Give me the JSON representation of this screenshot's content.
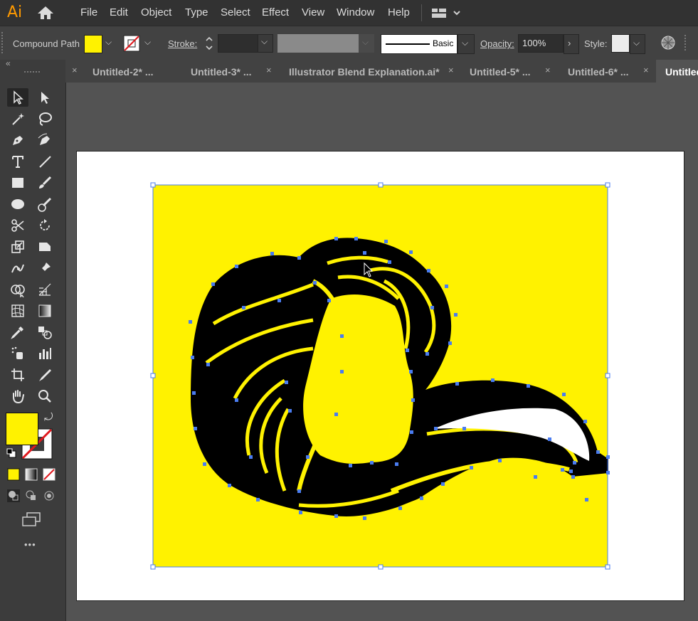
{
  "app": {
    "logo": "Ai"
  },
  "menu": {
    "items": [
      "File",
      "Edit",
      "Object",
      "Type",
      "Select",
      "Effect",
      "View",
      "Window",
      "Help"
    ]
  },
  "control": {
    "selection_label": "Compound Path",
    "fill_color": "#fff200",
    "stroke_label": "Stroke:",
    "stroke_style": "Basic",
    "opacity_label": "Opacity:",
    "opacity_value": "100%",
    "style_label": "Style:"
  },
  "tabs": [
    {
      "label": "Untitled-2* ...",
      "close": "×"
    },
    {
      "label": "Untitled-3* ...",
      "close": "×"
    },
    {
      "label": "Illustrator Blend Explanation.ai*",
      "close": "×"
    },
    {
      "label": "Untitled-5* ...",
      "close": "×"
    },
    {
      "label": "Untitled-6* ...",
      "close": "×"
    },
    {
      "label": "Untitled",
      "close": "×"
    }
  ],
  "toolbar": {
    "collapse": "«",
    "more": "•••",
    "fill_swatch": "#fff200",
    "icons": [
      "selection-tool",
      "direct-selection-tool",
      "magic-wand-tool",
      "lasso-tool",
      "pen-tool",
      "curvature-tool",
      "type-tool",
      "line-tool",
      "rectangle-tool",
      "paintbrush-tool",
      "ellipse-tool",
      "blob-brush-tool",
      "scissors-tool",
      "rotate-tool",
      "scale-tool",
      "free-transform-tool",
      "puppet-warp-tool",
      "pin-tool",
      "shape-builder-tool",
      "perspective-grid-tool",
      "mesh-tool",
      "gradient-tool",
      "eyedropper-tool",
      "blend-tool",
      "symbol-sprayer-tool",
      "column-graph-tool",
      "artboard-tool",
      "slice-tool",
      "hand-tool",
      "zoom-tool"
    ]
  },
  "colors": {
    "artwork_fill": "#fff200",
    "artwork_shape": "#000000",
    "selection": "#4a7cf0"
  }
}
